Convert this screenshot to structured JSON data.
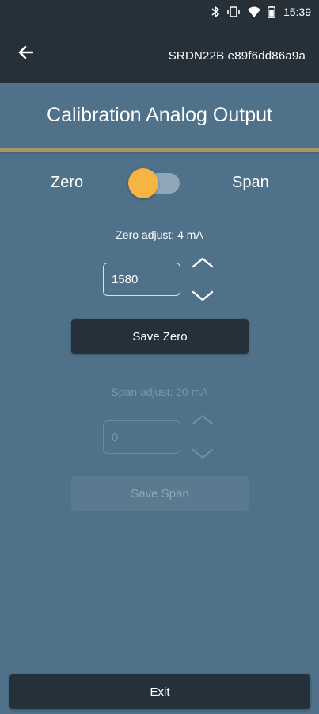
{
  "status_bar": {
    "time": "15:39",
    "icons": [
      "bluetooth-icon",
      "vibrate-icon",
      "wifi-icon",
      "battery-icon"
    ]
  },
  "app_bar": {
    "back_icon": "arrow-left-icon",
    "device_id": "SRDN22B e89f6dd86a9a"
  },
  "page": {
    "title": "Calibration Analog Output"
  },
  "mode_toggle": {
    "left_label": "Zero",
    "right_label": "Span",
    "selected": "Zero"
  },
  "zero": {
    "label": "Zero adjust: 4 mA",
    "value": "1580",
    "up_icon": "chevron-up-icon",
    "down_icon": "chevron-down-icon",
    "save_label": "Save Zero",
    "enabled": true
  },
  "span": {
    "label": "Span adjust: 20 mA",
    "value": "0",
    "up_icon": "chevron-up-icon",
    "down_icon": "chevron-down-icon",
    "save_label": "Save Span",
    "enabled": false
  },
  "footer": {
    "exit_label": "Exit"
  },
  "colors": {
    "bars": "#253039",
    "background": "#4f7189",
    "divider": "#a89466",
    "toggle_thumb": "#f6b443",
    "disabled_text": "#7f97a8"
  }
}
